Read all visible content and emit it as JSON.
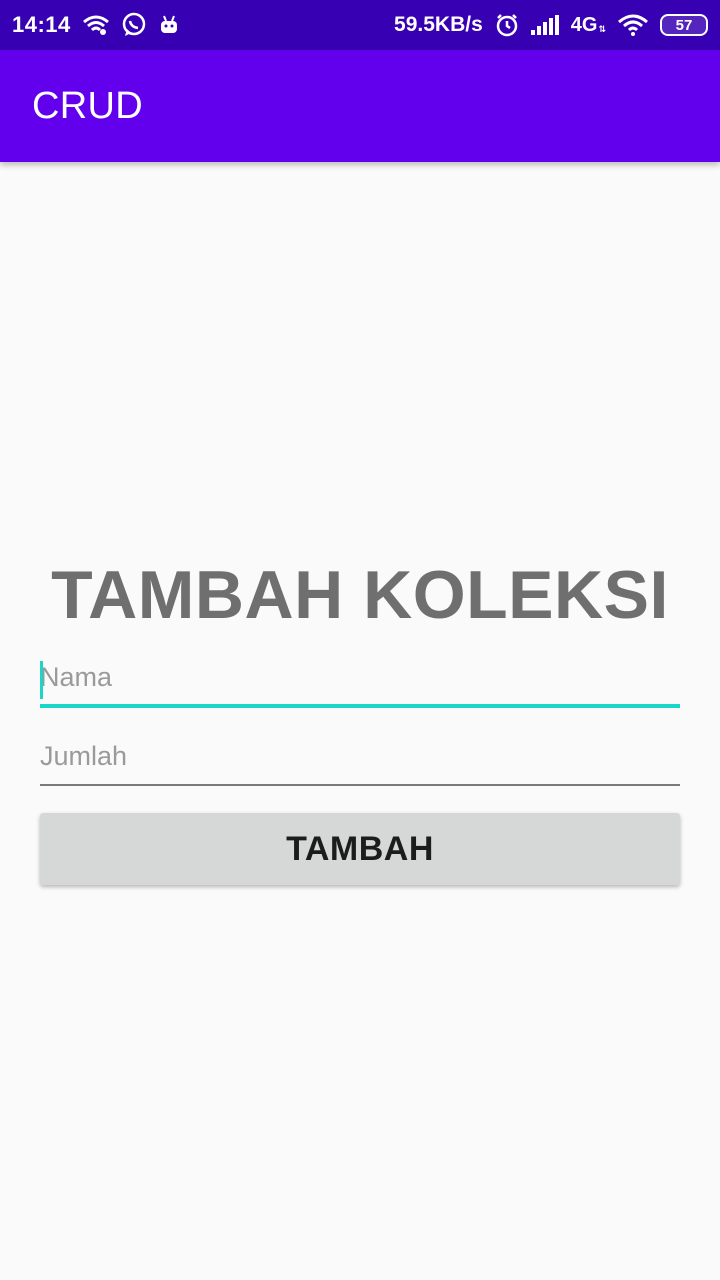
{
  "status_bar": {
    "time": "14:14",
    "speed": "59.5KB/s",
    "network": "4G",
    "battery": "57",
    "icons": [
      "wifi-hotspot-icon",
      "whatsapp-icon",
      "android-icon",
      "alarm-icon",
      "signal-icon",
      "wifi-icon",
      "battery-icon"
    ]
  },
  "app_bar": {
    "title": "CRUD",
    "color": "#6200ee"
  },
  "form": {
    "title": "TAMBAH KOLEKSI",
    "name_placeholder": "Nama",
    "name_value": "",
    "amount_placeholder": "Jumlah",
    "amount_value": "",
    "submit_label": "TAMBAH",
    "accent_color": "#1ad6c8"
  }
}
